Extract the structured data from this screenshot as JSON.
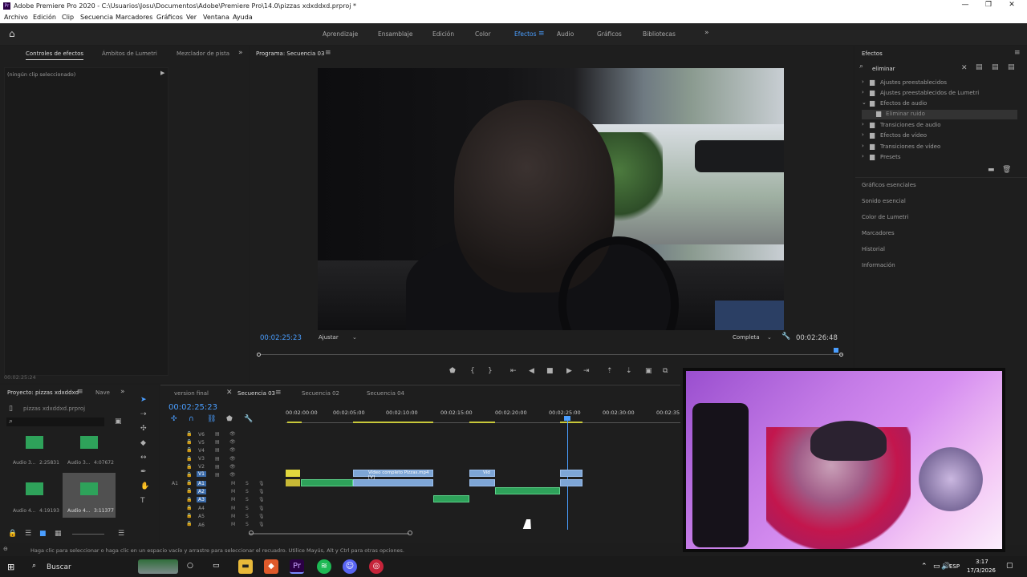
{
  "window": {
    "title": "Adobe Premiere Pro 2020 - C:\\Usuarios\\Josu\\Documentos\\Adobe\\Premiere Pro\\14.0\\pizzas xdxddxd.prproj *"
  },
  "menu": [
    "Archivo",
    "Edición",
    "Clip",
    "Secuencia",
    "Marcadores",
    "Gráficos",
    "Ver",
    "Ventana",
    "Ayuda"
  ],
  "workspaces": [
    "Aprendizaje",
    "Ensamblaje",
    "Edición",
    "Color",
    "Efectos",
    "Audio",
    "Gráficos",
    "Bibliotecas"
  ],
  "active_workspace": "Efectos",
  "source_panel": {
    "tabs": [
      "Controles de efectos",
      "Ámbitos de Lumetri",
      "Mezclador de pista"
    ],
    "no_clip": "(ningún clip seleccionado)",
    "timecode": "00:02:25:24"
  },
  "program": {
    "title": "Programa: Secuencia 03",
    "timecode": "00:02:25:23",
    "fit": "Ajustar",
    "quality": "Completa",
    "duration": "00:02:26:48"
  },
  "effects": {
    "title": "Efectos",
    "search": "eliminar",
    "tree": [
      {
        "label": "Ajustes preestablecidos",
        "level": 0
      },
      {
        "label": "Ajustes preestablecidos de Lumetri",
        "level": 0
      },
      {
        "label": "Efectos de audio",
        "level": 0
      },
      {
        "label": "Eliminar ruido",
        "level": 1
      },
      {
        "label": "Transiciones de audio",
        "level": 0
      },
      {
        "label": "Efectos de vídeo",
        "level": 0
      },
      {
        "label": "Transiciones de vídeo",
        "level": 0
      },
      {
        "label": "Presets",
        "level": 0
      }
    ],
    "panels": [
      "Gráficos esenciales",
      "Sonido esencial",
      "Color de Lumetri",
      "Marcadores",
      "Historial",
      "Información"
    ]
  },
  "project": {
    "title": "Proyecto: pizzas xdxddxd",
    "nav": "Nave",
    "file": "pizzas xdxddxd.prproj",
    "items": [
      {
        "name": "Audio 3...",
        "dur": "2:25831"
      },
      {
        "name": "Audio 3...",
        "dur": "4:07672"
      },
      {
        "name": "Audio 4...",
        "dur": "4:19193"
      },
      {
        "name": "Audio 4...",
        "dur": "3:11377"
      }
    ]
  },
  "timeline": {
    "tabs": [
      "version final",
      "Secuencia 03",
      "Secuencia 02",
      "Secuencia 04"
    ],
    "active_tab": "Secuencia 03",
    "timecode": "00:02:25:23",
    "ruler": [
      "00:02:00:00",
      "00:02:05:00",
      "00:02:10:00",
      "00:02:15:00",
      "00:02:20:00",
      "00:02:25:00",
      "00:02:30:00",
      "00:02:35"
    ],
    "video_tracks": [
      "V6",
      "V5",
      "V4",
      "V3",
      "V2",
      "V1"
    ],
    "audio_tracks": [
      "A1",
      "A2",
      "A3",
      "A4",
      "A5",
      "A6"
    ],
    "clips": {
      "main": "Vídeo completo Pizzas.mp4 [V]",
      "short": "Víd"
    }
  },
  "status": {
    "hint": "Haga clic para seleccionar o haga clic en un espacio vacío y arrastre para seleccionar el recuadro. Utilice Mayús, Alt y Ctrl para otras opciones."
  },
  "taskbar": {
    "search": "Buscar",
    "lang": "ESP",
    "time": "3:17",
    "date": "17/3/2026"
  }
}
